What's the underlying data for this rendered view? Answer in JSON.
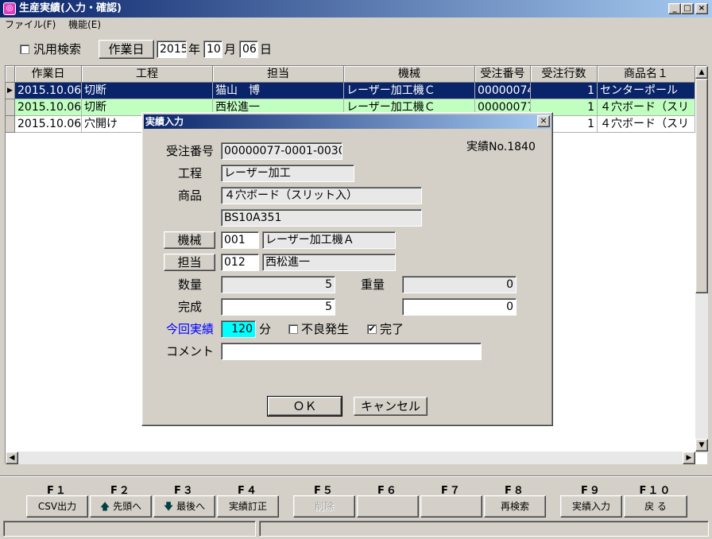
{
  "window": {
    "title": "生産実績(入力・確認)",
    "icon": "app-icon"
  },
  "menu": {
    "items": [
      "ファイル(F)",
      "機能(E)"
    ]
  },
  "filter": {
    "generic_search_label": "汎用検索",
    "work_date_button": "作業日",
    "year": "2015",
    "year_unit": "年",
    "month": "10",
    "month_unit": "月",
    "day": "06",
    "day_unit": "日"
  },
  "table": {
    "columns": [
      "作業日",
      "工程",
      "担当",
      "機械",
      "受注番号",
      "受注行数",
      "商品名１"
    ],
    "rows": [
      {
        "date": "2015.10.06",
        "process": "切断",
        "staff": "猫山　博",
        "machine": "レーザー加工機Ｃ",
        "order_no": "00000074",
        "lines": "1",
        "product": "センターポール",
        "state": "selected"
      },
      {
        "date": "2015.10.06",
        "process": "切断",
        "staff": "西松進一",
        "machine": "レーザー加工機Ｃ",
        "order_no": "00000077",
        "lines": "1",
        "product": "４穴ボード（スリ",
        "state": "highlighted"
      },
      {
        "date": "2015.10.06",
        "process": "穴開け",
        "staff": "",
        "machine": "",
        "order_no": "",
        "lines": "1",
        "product": "４穴ボード（スリ",
        "state": "normal"
      }
    ]
  },
  "dialog": {
    "title": "実績入力",
    "record_no": "実績No.1840",
    "order_no_label": "受注番号",
    "order_no": "00000077-0001-0030",
    "process_label": "工程",
    "process": "レーザー加工",
    "product_label": "商品",
    "product_name": "４穴ボード（スリット入）",
    "product_code": "BS10A351",
    "machine_button": "機械",
    "machine_code": "001",
    "machine_name": "レーザー加工機Ａ",
    "staff_button": "担当",
    "staff_code": "012",
    "staff_name": "西松進一",
    "quantity_label": "数量",
    "quantity": "5",
    "weight_label": "重量",
    "weight": "0",
    "complete_label": "完成",
    "complete_qty": "5",
    "complete_weight": "0",
    "current_label": "今回実績",
    "current_value": "120",
    "minutes_unit": "分",
    "defect_label": "不良発生",
    "defect_checked": false,
    "done_label": "完了",
    "done_checked": true,
    "comment_label": "コメント",
    "comment": "",
    "ok_button": "ＯＫ",
    "cancel_button": "キャンセル"
  },
  "fkeys": [
    {
      "key": "F１",
      "label": "CSV出力",
      "enabled": true
    },
    {
      "key": "F２",
      "label": "先頭へ",
      "icon": "arrow-up-icon",
      "enabled": true
    },
    {
      "key": "F３",
      "label": "最後へ",
      "icon": "arrow-down-icon",
      "enabled": true
    },
    {
      "key": "F４",
      "label": "実績訂正",
      "enabled": true
    },
    {
      "key": "F５",
      "label": "削除",
      "enabled": false
    },
    {
      "key": "F６",
      "label": "",
      "enabled": false
    },
    {
      "key": "F７",
      "label": "",
      "enabled": false
    },
    {
      "key": "F８",
      "label": "再検索",
      "enabled": true
    },
    {
      "key": "F９",
      "label": "実績入力",
      "enabled": true
    },
    {
      "key": "F１０",
      "label": "戻 る",
      "enabled": true
    }
  ],
  "colors": {
    "title_bar": "#0a246a",
    "selected_row": "#0a246a",
    "highlight_row": "#c0ffc0",
    "active_input": "#00ffff",
    "accent_label": "#0000ff"
  }
}
